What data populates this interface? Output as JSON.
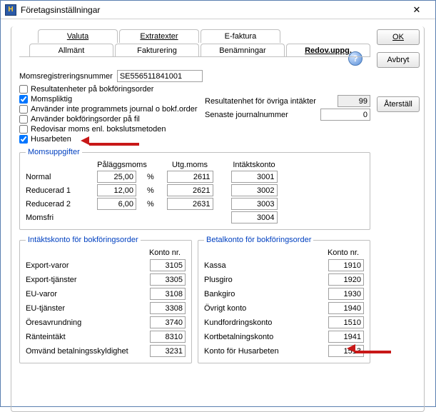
{
  "window": {
    "title": "Företagsinställningar"
  },
  "tabs_top": {
    "valuta": "Valuta",
    "extratexter": "Extratexter",
    "efaktura": "E-faktura"
  },
  "tabs_bottom": {
    "allmant": "Allmänt",
    "fakturering": "Fakturering",
    "benamningar": "Benämningar",
    "redov": "Redov.uppg."
  },
  "buttons": {
    "ok": "OK",
    "avbryt": "Avbryt",
    "aterstall": "Återställ"
  },
  "momsreg": {
    "label": "Momsregistreringsnummer",
    "value": "SE556511841001"
  },
  "checkboxes": {
    "resultatenheter": {
      "label": "Resultatenheter på bokföringsorder",
      "checked": false
    },
    "momspliktig": {
      "label": "Momspliktig",
      "checked": true
    },
    "anvinte": {
      "label": "Använder inte programmets journal o bokf.order",
      "checked": false
    },
    "anvfil": {
      "label": "Använder bokföringsorder på fil",
      "checked": false
    },
    "redovisar": {
      "label": "Redovisar moms enl. bokslutsmetoden",
      "checked": false
    },
    "husarbeten": {
      "label": "Husarbeten",
      "checked": true
    }
  },
  "rightfields": {
    "resultatenhet": {
      "label": "Resultatenhet för övriga intäkter",
      "value": "99"
    },
    "senaste": {
      "label": "Senaste journalnummer",
      "value": "0"
    }
  },
  "momsuppg": {
    "legend": "Momsuppgifter",
    "headers": {
      "palagg": "Påläggsmoms",
      "utg": "Utg.moms",
      "intakt": "Intäktskonto"
    },
    "rows": {
      "normal": {
        "label": "Normal",
        "palagg": "25,00",
        "utg": "2611",
        "intakt": "3001"
      },
      "red1": {
        "label": "Reducerad 1",
        "palagg": "12,00",
        "utg": "2621",
        "intakt": "3002"
      },
      "red2": {
        "label": "Reducerad 2",
        "palagg": "6,00",
        "utg": "2631",
        "intakt": "3003"
      },
      "momsfri": {
        "label": "Momsfri",
        "palagg": "",
        "utg": "",
        "intakt": "3004"
      }
    },
    "pct": "%"
  },
  "intaktskonto": {
    "legend": "Intäktskonto för bokföringsorder",
    "konto_hdr": "Konto nr.",
    "rows": {
      "expvaror": {
        "label": "Export-varor",
        "value": "3105"
      },
      "exptjanst": {
        "label": "Export-tjänster",
        "value": "3305"
      },
      "euvaror": {
        "label": "EU-varor",
        "value": "3108"
      },
      "eutjanst": {
        "label": "EU-tjänster",
        "value": "3308"
      },
      "oresav": {
        "label": "Öresavrundning",
        "value": "3740"
      },
      "rante": {
        "label": "Ränteintäkt",
        "value": "8310"
      },
      "omvand": {
        "label": "Omvänd betalningsskyldighet",
        "value": "3231"
      }
    }
  },
  "betalkonto": {
    "legend": "Betalkonto för bokföringsorder",
    "konto_hdr": "Konto nr.",
    "rows": {
      "kassa": {
        "label": "Kassa",
        "value": "1910"
      },
      "plusg": {
        "label": "Plusgiro",
        "value": "1920"
      },
      "bankg": {
        "label": "Bankgiro",
        "value": "1930"
      },
      "ovrigt": {
        "label": "Övrigt konto",
        "value": "1940"
      },
      "kundf": {
        "label": "Kundfordringskonto",
        "value": "1510"
      },
      "kortb": {
        "label": "Kortbetalningskonto",
        "value": "1941"
      },
      "hus": {
        "label": "Konto för Husarbeten",
        "value": "1513"
      }
    }
  }
}
